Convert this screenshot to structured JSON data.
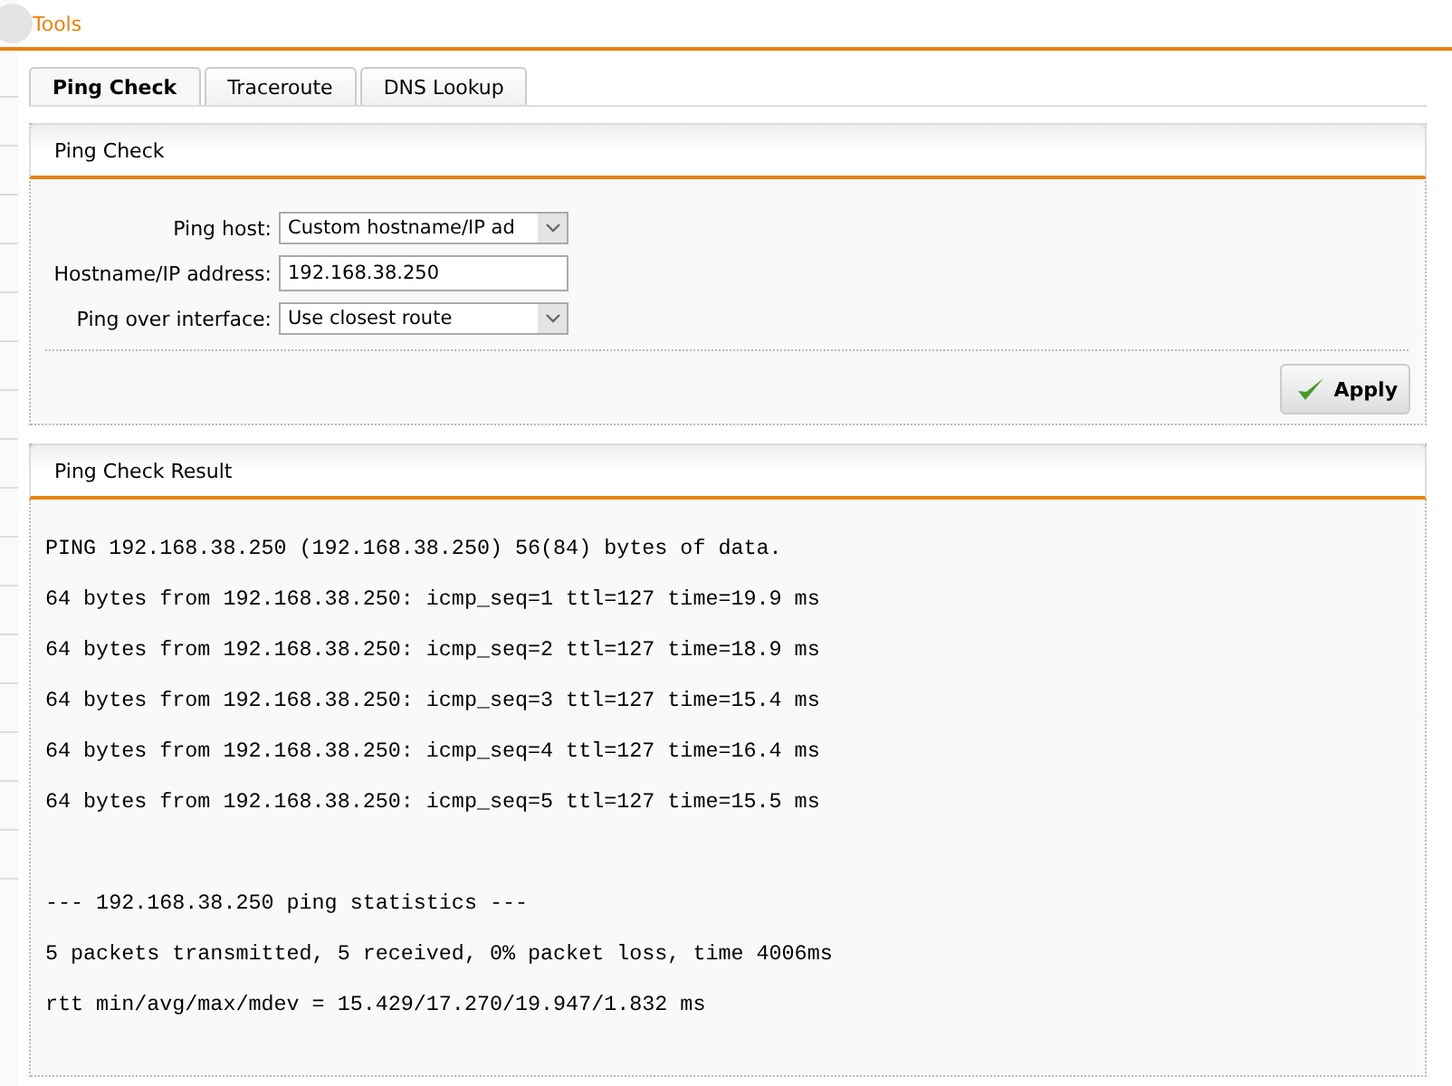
{
  "section_title": "Tools",
  "tabs": [
    {
      "label": "Ping Check",
      "selected": true
    },
    {
      "label": "Traceroute",
      "selected": false
    },
    {
      "label": "DNS Lookup",
      "selected": false
    }
  ],
  "settings_panel": {
    "title": "Ping Check",
    "fields": [
      {
        "kind": "select",
        "label": "Ping host:",
        "value": "Custom hostname/IP ad"
      },
      {
        "kind": "input",
        "label": "Hostname/IP address:",
        "value": "192.168.38.250"
      },
      {
        "kind": "select",
        "label": "Ping over interface:",
        "value": "Use closest route"
      }
    ],
    "apply_button": "Apply"
  },
  "result_panel": {
    "title": "Ping Check Result",
    "reply_lines": [
      "PING 192.168.38.250 (192.168.38.250) 56(84) bytes of data.",
      "64 bytes from 192.168.38.250: icmp_seq=1 ttl=127 time=19.9 ms",
      "64 bytes from 192.168.38.250: icmp_seq=2 ttl=127 time=18.9 ms",
      "64 bytes from 192.168.38.250: icmp_seq=3 ttl=127 time=15.4 ms",
      "64 bytes from 192.168.38.250: icmp_seq=4 ttl=127 time=16.4 ms",
      "64 bytes from 192.168.38.250: icmp_seq=5 ttl=127 time=15.5 ms"
    ],
    "statistics_lines": [
      "--- 192.168.38.250 ping statistics ---",
      "5 packets transmitted, 5 received, 0% packet loss, time 4006ms",
      "rtt min/avg/max/mdev = 15.429/17.270/19.947/1.832 ms"
    ]
  }
}
